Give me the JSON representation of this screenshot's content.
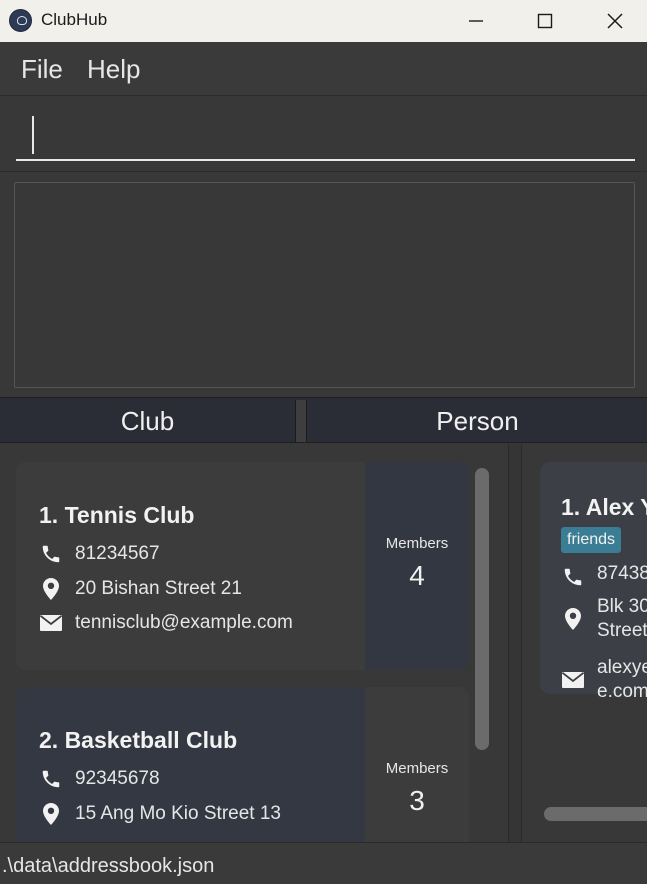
{
  "window": {
    "title": "ClubHub",
    "app_icon": "clubhub-logo-icon"
  },
  "menu": {
    "items": [
      {
        "label": "File"
      },
      {
        "label": "Help"
      }
    ]
  },
  "command": {
    "value": "",
    "placeholder": ""
  },
  "result": {
    "text": ""
  },
  "tabs": [
    {
      "label": "Club"
    },
    {
      "label": "Person"
    }
  ],
  "clubs": [
    {
      "name": "1. Tennis Club",
      "phone": "81234567",
      "address": "20 Bishan Street 21",
      "email": "tennisclub@example.com",
      "members_label": "Members",
      "members_count": "4"
    },
    {
      "name": "2. Basketball Club",
      "phone": "92345678",
      "address": "15 Ang Mo Kio Street 13",
      "members_label": "Members",
      "members_count": "3"
    }
  ],
  "persons": [
    {
      "name": "1. Alex Y",
      "tag": "friends",
      "phone": "87438",
      "address_line1": "Blk 30",
      "address_line2": "Street",
      "email_line1": "alexye",
      "email_line2": "e.com"
    }
  ],
  "status": {
    "path": ".\\data\\addressbook.json"
  },
  "colors": {
    "background": "#383838",
    "tag": "#3a7d94",
    "titlebar": "#f2f0ea"
  }
}
